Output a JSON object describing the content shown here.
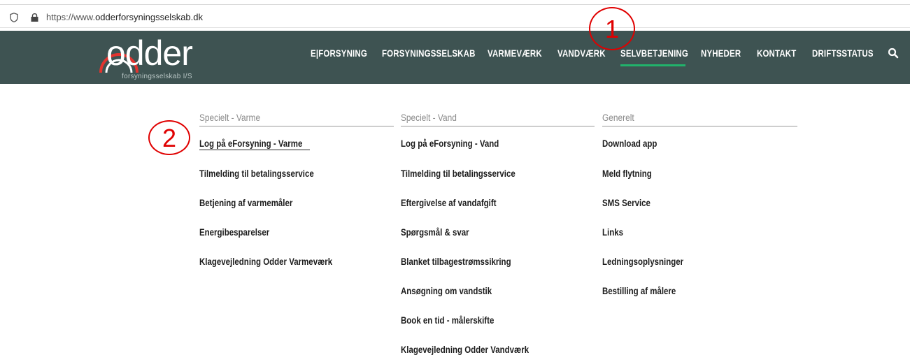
{
  "browser": {
    "url_prefix": "https://www.",
    "url_domain": "odderforsyningsselskab.dk"
  },
  "logo": {
    "wordmark": "odder",
    "subtitle": "forsyningsselskab I/S"
  },
  "nav": {
    "items": [
      {
        "label": "E|FORSYNING"
      },
      {
        "label": "FORSYNINGSSELSKAB"
      },
      {
        "label": "VARMEVÆRK"
      },
      {
        "label": "VANDVÆRK"
      },
      {
        "label": "SELVBETJENING",
        "active": true
      },
      {
        "label": "NYHEDER"
      },
      {
        "label": "KONTAKT"
      },
      {
        "label": "DRIFTSSTATUS"
      }
    ],
    "search_icon": "search-icon"
  },
  "annotations": [
    "1",
    "2"
  ],
  "menu": {
    "columns": [
      {
        "heading": "Specielt - Varme",
        "items": [
          "Log på eForsyning - Varme",
          "Tilmelding til betalingsservice",
          "Betjening af varmemåler",
          "Energibesparelser",
          "Klagevejledning Odder Varmeværk"
        ]
      },
      {
        "heading": "Specielt - Vand",
        "items": [
          "Log på eForsyning - Vand",
          "Tilmelding til betalingsservice",
          "Eftergivelse af vandafgift",
          "Spørgsmål & svar",
          "Blanket tilbagestrømssikring",
          "Ansøgning om vandstik",
          "Book en tid - målerskifte",
          "Klagevejledning Odder Vandværk"
        ]
      },
      {
        "heading": "Generelt",
        "items": [
          "Download app",
          "Meld flytning",
          "SMS Service",
          "Links",
          "Ledningsoplysninger",
          "Bestilling af målere"
        ]
      }
    ]
  },
  "colors": {
    "nav_bg": "#3e5352",
    "active_underline": "#21b26b",
    "annotation": "#e00000"
  }
}
